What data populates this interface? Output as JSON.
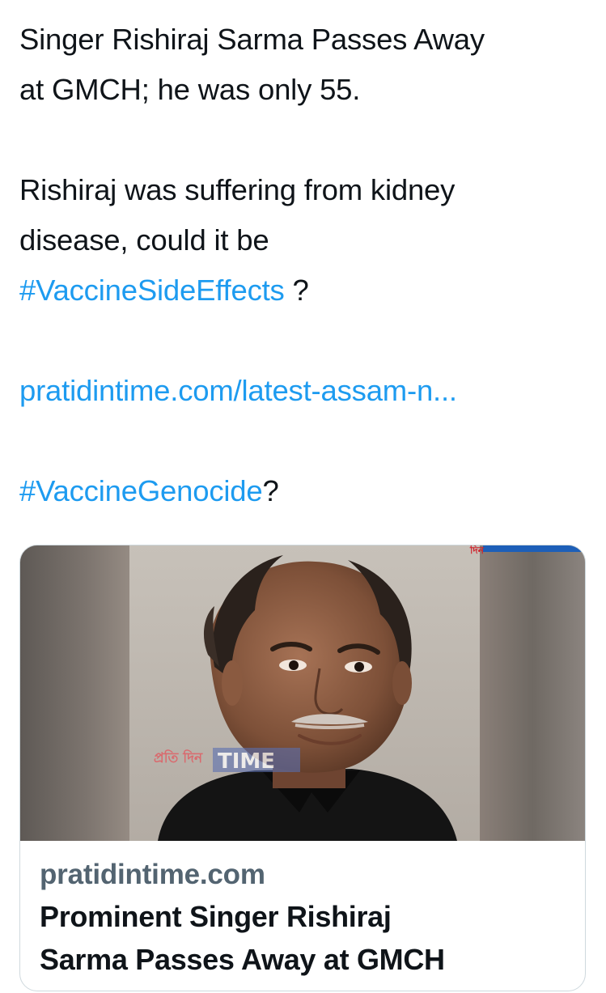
{
  "tweet": {
    "line1": "Singer Rishiraj Sarma Passes Away",
    "line2": "at GMCH; he was only 55.",
    "line3": "Rishiraj was suffering from kidney",
    "line4": "disease, could it be",
    "hashtag_side_effects": "#VaccineSideEffects",
    "after_side_effects": " ?",
    "url": "pratidintime.com/latest-assam-n...",
    "hashtag_genocide": "#VaccineGenocide",
    "after_genocide": "?"
  },
  "card": {
    "domain": "pratidintime.com",
    "title_line1": "Prominent Singer Rishiraj",
    "title_line2": "Sarma Passes Away at GMCH",
    "watermark_bengali": "প্রতি দিন",
    "watermark_time": "TIME",
    "corner_logo": "দিন"
  },
  "colors": {
    "link": "#1d9bf0",
    "text": "#0f1419",
    "secondary": "#536471",
    "border": "#cfd9de"
  }
}
